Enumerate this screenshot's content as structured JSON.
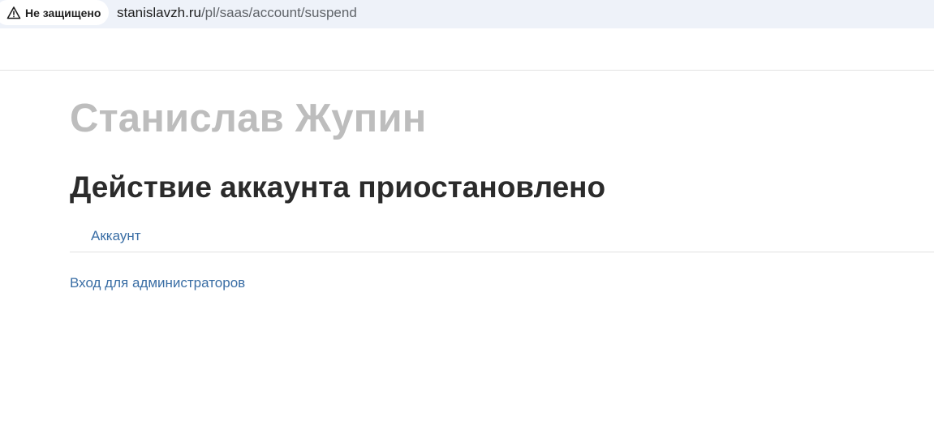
{
  "browser": {
    "security_label": "Не защищено",
    "security_icon": "warning-triangle-icon",
    "url_host": "stanislavzh.ru",
    "url_path": "/pl/saas/account/suspend"
  },
  "page": {
    "site_title": "Станислав Жупин",
    "heading": "Действие аккаунта приостановлено",
    "nav_tab_label": "Аккаунт",
    "admin_login_label": "Вход для администраторов"
  },
  "colors": {
    "link": "#3a6ea5",
    "site_title": "#bdbdbd",
    "heading": "#2b2b2b",
    "address_bar_bg": "#eef2f9"
  }
}
